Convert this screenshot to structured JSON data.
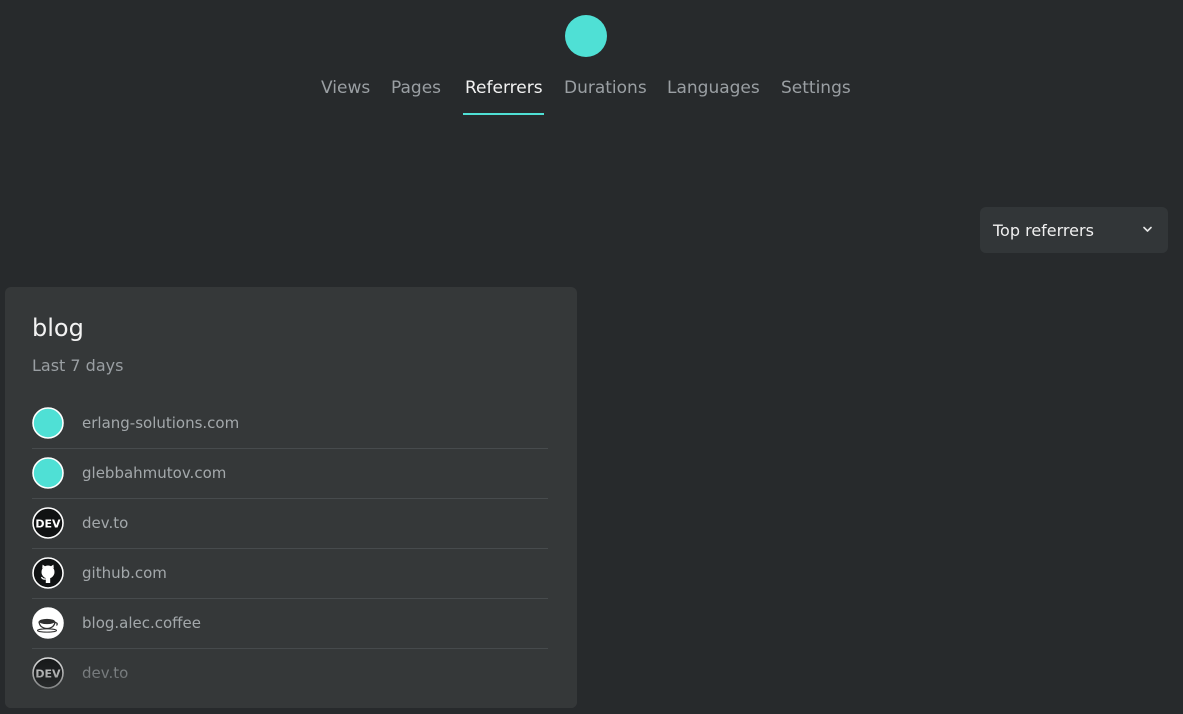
{
  "nav": {
    "tabs": [
      {
        "label": "Views",
        "active": false
      },
      {
        "label": "Pages",
        "active": false
      },
      {
        "label": "Referrers",
        "active": true
      },
      {
        "label": "Durations",
        "active": false
      },
      {
        "label": "Languages",
        "active": false
      },
      {
        "label": "Settings",
        "active": false
      }
    ]
  },
  "dropdown": {
    "selected": "Top referrers"
  },
  "card": {
    "title": "blog",
    "subtitle": "Last 7 days",
    "referrers": [
      {
        "name": "erlang-solutions.com",
        "icon": "teal-circle-icon"
      },
      {
        "name": "glebbahmutov.com",
        "icon": "teal-circle-icon"
      },
      {
        "name": "dev.to",
        "icon": "dev-logo-icon"
      },
      {
        "name": "github.com",
        "icon": "github-icon"
      },
      {
        "name": "blog.alec.coffee",
        "icon": "coffee-cup-icon"
      },
      {
        "name": "dev.to",
        "icon": "dev-logo-icon"
      }
    ]
  },
  "colors": {
    "accent": "#4fe0d5",
    "background": "#272a2c",
    "card": "#353839"
  }
}
